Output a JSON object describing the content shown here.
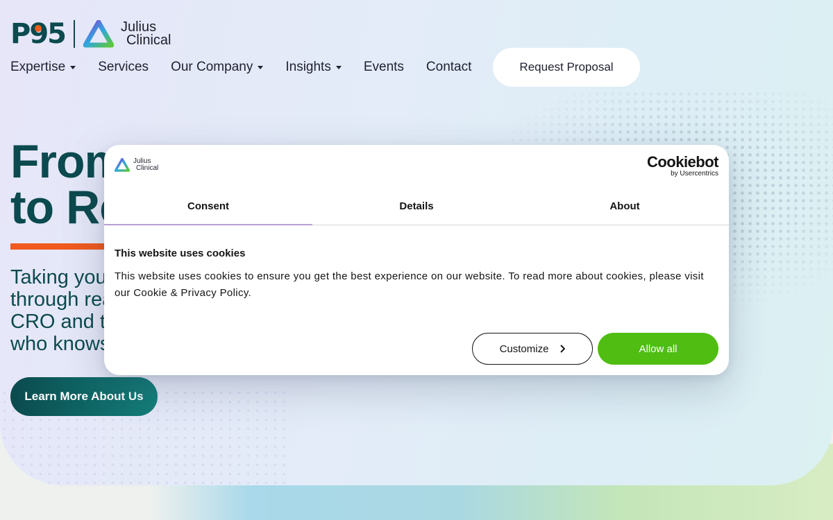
{
  "brand": {
    "logo_text": "P95",
    "partner_logo_line1": "Julius",
    "partner_logo_line2": "Clinical"
  },
  "nav": {
    "items": [
      {
        "label": "Expertise",
        "has_dropdown": true
      },
      {
        "label": "Services",
        "has_dropdown": false
      },
      {
        "label": "Our Company",
        "has_dropdown": true
      },
      {
        "label": "Insights",
        "has_dropdown": true
      },
      {
        "label": "Events",
        "has_dropdown": false
      },
      {
        "label": "Contact",
        "has_dropdown": false
      }
    ],
    "cta_label": "Request Proposal"
  },
  "hero": {
    "title_line1": "From",
    "title_line2": "to Re",
    "subtitle_line1": "Taking you",
    "subtitle_line2": "through rea",
    "subtitle_line3": "CRO and t",
    "subtitle_line4": "who knows",
    "button_label": "Learn More About Us"
  },
  "cookie_dialog": {
    "logo_line1": "Julius",
    "logo_line2": "Clinical",
    "provider_name": "Cookiebot",
    "provider_sub": "by Usercentrics",
    "tabs": [
      {
        "label": "Consent",
        "active": true
      },
      {
        "label": "Details",
        "active": false
      },
      {
        "label": "About",
        "active": false
      }
    ],
    "heading": "This website uses cookies",
    "body": "This website uses cookies to ensure you get the best experience on our website. To read more about cookies, please visit our Cookie & Privacy Policy.",
    "customize_label": "Customize",
    "allow_label": "Allow all"
  },
  "colors": {
    "brand_teal": "#0b4a4e",
    "accent_orange": "#f05a1e",
    "allow_green": "#4fbd12",
    "tab_underline": "#b79fd0"
  }
}
